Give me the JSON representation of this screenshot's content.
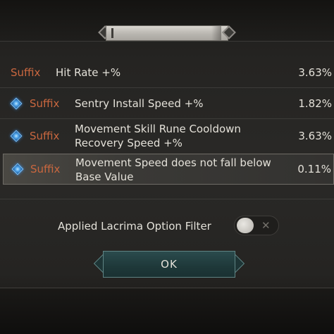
{
  "dialog": {
    "title": ""
  },
  "options": [
    {
      "type": "Suffix",
      "text_lines": [
        "Hit Rate +%"
      ],
      "value": "3.63%",
      "has_gem": false,
      "selected": false
    },
    {
      "type": "Suffix",
      "text_lines": [
        "Sentry Install Speed +%"
      ],
      "value": "1.82%",
      "has_gem": true,
      "selected": false
    },
    {
      "type": "Suffix",
      "text_lines": [
        "Movement Skill Rune Cooldown",
        "Recovery Speed +%"
      ],
      "value": "3.63%",
      "has_gem": true,
      "selected": false
    },
    {
      "type": "Suffix",
      "text_lines": [
        "Movement Speed does not fall below",
        "Base Value"
      ],
      "value": "0.11%",
      "has_gem": true,
      "selected": true
    }
  ],
  "filter": {
    "label": "Applied Lacrima Option Filter",
    "toggle_off_symbol": "✕",
    "enabled": false
  },
  "ok_button": {
    "label": "OK"
  },
  "colors": {
    "suffix": "#c9673f",
    "text": "#e4e1d9",
    "gem": "#4aa0e8",
    "button": "#1e3839"
  },
  "icons": {
    "gem": "blue-gem-icon",
    "toggle_knob": "toggle-knob-icon",
    "close": "close-icon"
  }
}
